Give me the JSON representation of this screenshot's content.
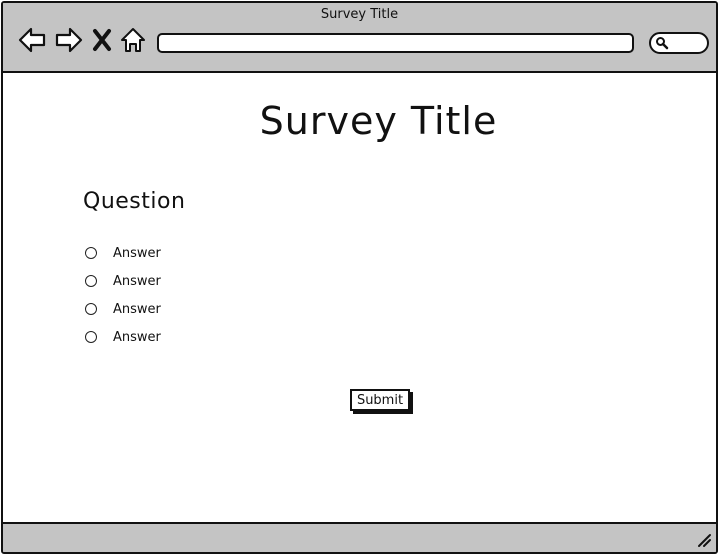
{
  "window": {
    "title": "Survey Title"
  },
  "toolbar": {
    "icons": [
      "back-arrow-icon",
      "forward-arrow-icon",
      "stop-icon",
      "home-icon",
      "search-icon"
    ],
    "address_value": "",
    "search_value": ""
  },
  "page": {
    "title": "Survey Title",
    "question": "Question",
    "answers": [
      {
        "label": "Answer"
      },
      {
        "label": "Answer"
      },
      {
        "label": "Answer"
      },
      {
        "label": "Answer"
      }
    ],
    "submit_label": "Submit"
  },
  "colors": {
    "chrome": "#c4c4c4",
    "ink": "#111111",
    "background": "#ffffff"
  }
}
